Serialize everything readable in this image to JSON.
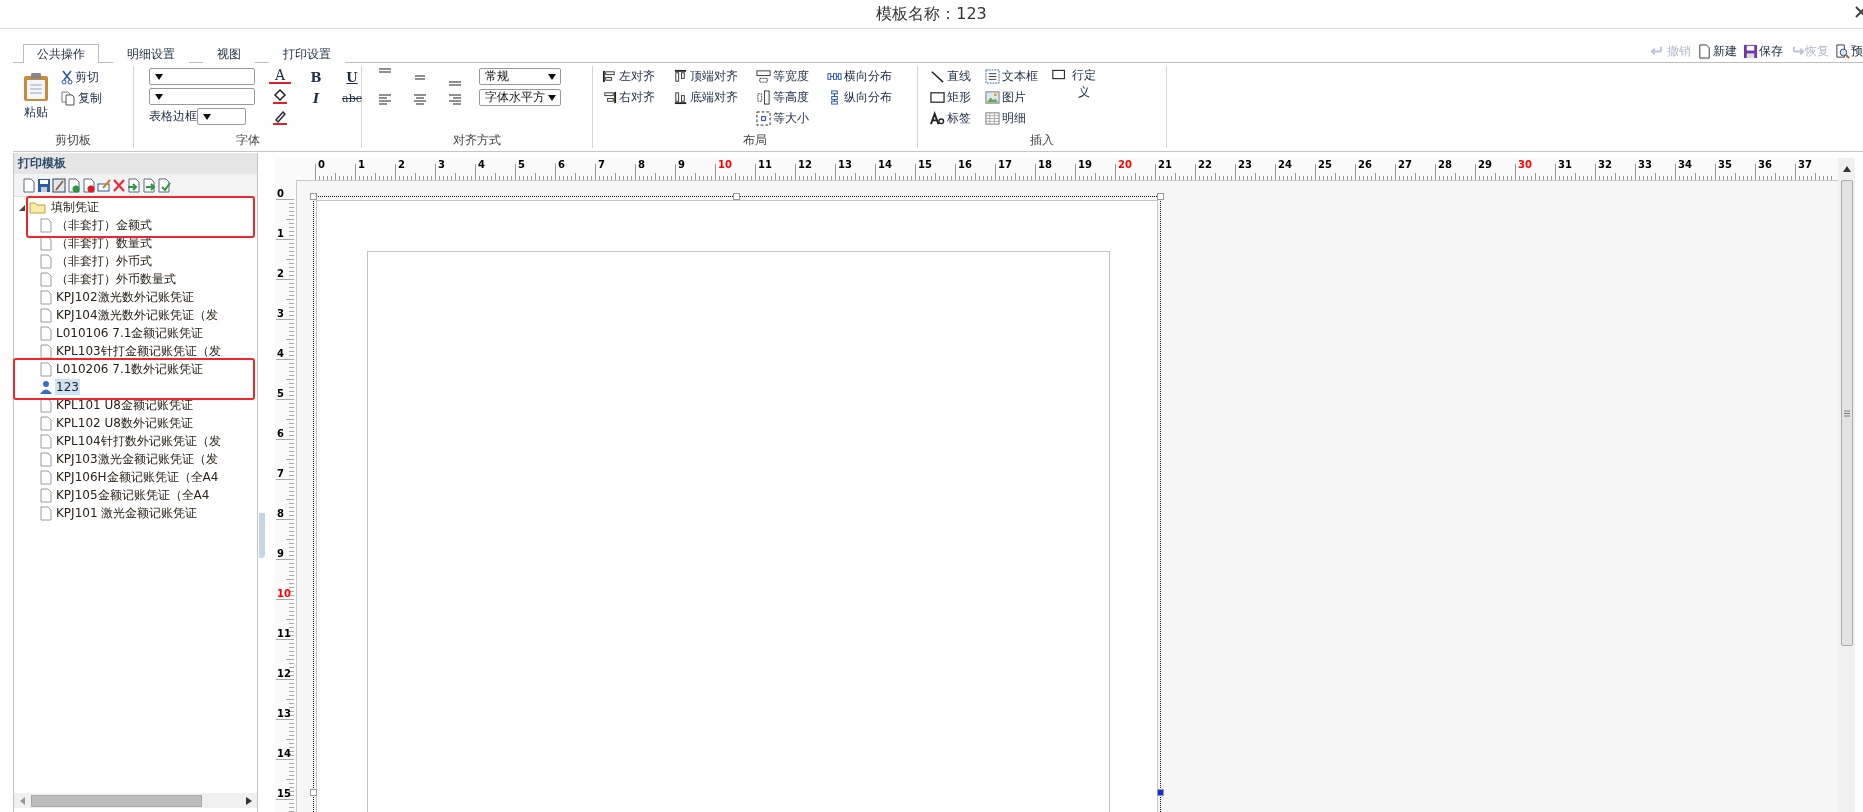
{
  "window": {
    "title": "模板名称：123"
  },
  "ribbon": {
    "tabs": [
      {
        "label": "公共操作",
        "selected": true
      },
      {
        "label": "明细设置",
        "selected": false
      },
      {
        "label": "视图",
        "selected": false
      },
      {
        "label": "打印设置",
        "selected": false
      }
    ],
    "actions": [
      {
        "label": "撤销",
        "kind": "undo",
        "disabled": true
      },
      {
        "label": "新建",
        "kind": "new",
        "disabled": false
      },
      {
        "label": "保存",
        "kind": "save",
        "disabled": false
      },
      {
        "label": "恢复",
        "kind": "redo",
        "disabled": true
      },
      {
        "label": "预",
        "kind": "preview",
        "disabled": false
      }
    ],
    "clipboard": {
      "paste": "粘贴",
      "cut": "剪切",
      "copy": "复制",
      "caption": "剪切板"
    },
    "font": {
      "border_label": "表格边框",
      "color_letter": "A",
      "bold": "B",
      "italic": "I",
      "underline": "U",
      "strike": "abc",
      "caption": "字体"
    },
    "alignment": {
      "style_value": "常规",
      "direction_value": "字体水平方",
      "caption": "对齐方式"
    },
    "layout": {
      "columns": [
        {
          "items": [
            {
              "label": "左对齐",
              "kind": "align-left"
            },
            {
              "label": "右对齐",
              "kind": "align-right"
            }
          ]
        },
        {
          "items": [
            {
              "label": "顶端对齐",
              "kind": "align-top"
            },
            {
              "label": "底端对齐",
              "kind": "align-bottom"
            }
          ]
        },
        {
          "items": [
            {
              "label": "等宽度",
              "kind": "same-width"
            },
            {
              "label": "等高度",
              "kind": "same-height"
            },
            {
              "label": "等大小",
              "kind": "same-size"
            }
          ]
        },
        {
          "items": [
            {
              "label": "横向分布",
              "kind": "distribute-h"
            },
            {
              "label": "纵向分布",
              "kind": "distribute-v"
            }
          ]
        }
      ],
      "caption": "布局"
    },
    "insert": {
      "columns": [
        {
          "items": [
            {
              "label": "直线",
              "kind": "line"
            },
            {
              "label": "矩形",
              "kind": "rect"
            },
            {
              "label": "标签",
              "kind": "label"
            }
          ]
        },
        {
          "items": [
            {
              "label": "文本框",
              "kind": "textbox"
            },
            {
              "label": "图片",
              "kind": "image"
            },
            {
              "label": "明细",
              "kind": "detail"
            }
          ]
        },
        {
          "items": [
            {
              "label": "行定义",
              "kind": "rowdef"
            }
          ]
        }
      ],
      "caption": "插入"
    }
  },
  "templates": {
    "title": "打印模板",
    "tree": [
      {
        "label": "填制凭证",
        "kind": "folder",
        "expanded": true,
        "selected": false,
        "marked": true,
        "children": [
          {
            "label": "（非套打）金额式",
            "kind": "file",
            "selected": false,
            "marked": true
          },
          {
            "label": "（非套打）数量式",
            "kind": "file",
            "selected": false,
            "marked": false
          },
          {
            "label": "（非套打）外币式",
            "kind": "file",
            "selected": false,
            "marked": false
          },
          {
            "label": "（非套打）外币数量式",
            "kind": "file",
            "selected": false,
            "marked": false
          },
          {
            "label": "KPJ102激光数外记账凭证",
            "kind": "file",
            "selected": false,
            "marked": false
          },
          {
            "label": "KPJ104激光数外记账凭证（发",
            "kind": "file",
            "selected": false,
            "marked": false
          },
          {
            "label": "L010106 7.1金额记账凭证",
            "kind": "file",
            "selected": false,
            "marked": false
          },
          {
            "label": "KPL103针打金额记账凭证（发",
            "kind": "file",
            "selected": false,
            "marked": false
          },
          {
            "label": "L010206 7.1数外记账凭证",
            "kind": "file",
            "selected": false,
            "marked": true
          },
          {
            "label": "123",
            "kind": "user",
            "selected": true,
            "marked": true
          },
          {
            "label": "KPL101 U8金额记账凭证",
            "kind": "file",
            "selected": false,
            "marked": false
          },
          {
            "label": "KPL102 U8数外记账凭证",
            "kind": "file",
            "selected": false,
            "marked": false
          },
          {
            "label": "KPL104针打数外记账凭证（发",
            "kind": "file",
            "selected": false,
            "marked": false
          },
          {
            "label": "KPJ103激光金额记账凭证（发",
            "kind": "file",
            "selected": false,
            "marked": false
          },
          {
            "label": "KPJ106H金额记账凭证（全A4",
            "kind": "file",
            "selected": false,
            "marked": false
          },
          {
            "label": "KPJ105金额记账凭证（全A4",
            "kind": "file",
            "selected": false,
            "marked": false
          },
          {
            "label": "KPJ101 激光金额记账凭证",
            "kind": "file",
            "selected": false,
            "marked": false
          }
        ]
      }
    ]
  },
  "ruler": {
    "horizontal": [
      {
        "label": "0",
        "color": "#000000"
      },
      {
        "label": "1",
        "color": "#000000"
      },
      {
        "label": "2",
        "color": "#000000"
      },
      {
        "label": "3",
        "color": "#000000"
      },
      {
        "label": "4",
        "color": "#000000"
      },
      {
        "label": "5",
        "color": "#000000"
      },
      {
        "label": "6",
        "color": "#000000"
      },
      {
        "label": "7",
        "color": "#000000"
      },
      {
        "label": "8",
        "color": "#000000"
      },
      {
        "label": "9",
        "color": "#000000"
      },
      {
        "label": "10",
        "color": "#ff0000"
      },
      {
        "label": "11",
        "color": "#000000"
      },
      {
        "label": "12",
        "color": "#000000"
      },
      {
        "label": "13",
        "color": "#000000"
      },
      {
        "label": "14",
        "color": "#000000"
      },
      {
        "label": "15",
        "color": "#000000"
      },
      {
        "label": "16",
        "color": "#000000"
      },
      {
        "label": "17",
        "color": "#000000"
      },
      {
        "label": "18",
        "color": "#000000"
      },
      {
        "label": "19",
        "color": "#000000"
      },
      {
        "label": "20",
        "color": "#ff0000"
      },
      {
        "label": "21",
        "color": "#000000"
      },
      {
        "label": "22",
        "color": "#000000"
      },
      {
        "label": "23",
        "color": "#000000"
      },
      {
        "label": "24",
        "color": "#000000"
      },
      {
        "label": "25",
        "color": "#000000"
      },
      {
        "label": "26",
        "color": "#000000"
      },
      {
        "label": "27",
        "color": "#000000"
      },
      {
        "label": "28",
        "color": "#000000"
      },
      {
        "label": "29",
        "color": "#000000"
      },
      {
        "label": "30",
        "color": "#ff0000"
      },
      {
        "label": "31",
        "color": "#000000"
      },
      {
        "label": "32",
        "color": "#000000"
      },
      {
        "label": "33",
        "color": "#000000"
      },
      {
        "label": "34",
        "color": "#000000"
      },
      {
        "label": "35",
        "color": "#000000"
      },
      {
        "label": "36",
        "color": "#000000"
      },
      {
        "label": "37",
        "color": "#000000"
      }
    ],
    "vertical": [
      {
        "label": "0",
        "color": "#000000"
      },
      {
        "label": "1",
        "color": "#000000"
      },
      {
        "label": "2",
        "color": "#000000"
      },
      {
        "label": "3",
        "color": "#000000"
      },
      {
        "label": "4",
        "color": "#000000"
      },
      {
        "label": "5",
        "color": "#000000"
      },
      {
        "label": "6",
        "color": "#000000"
      },
      {
        "label": "7",
        "color": "#000000"
      },
      {
        "label": "8",
        "color": "#000000"
      },
      {
        "label": "9",
        "color": "#000000"
      },
      {
        "label": "10",
        "color": "#ff0000"
      },
      {
        "label": "11",
        "color": "#000000"
      },
      {
        "label": "12",
        "color": "#000000"
      },
      {
        "label": "13",
        "color": "#000000"
      },
      {
        "label": "14",
        "color": "#000000"
      },
      {
        "label": "15",
        "color": "#000000"
      }
    ]
  }
}
